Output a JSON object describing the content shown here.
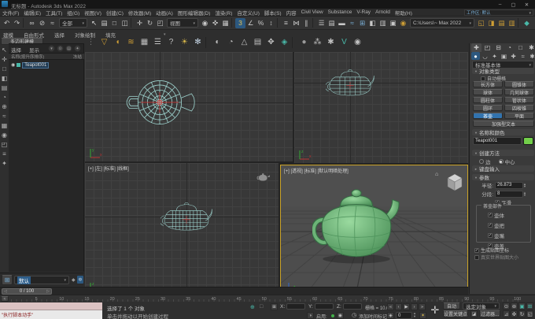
{
  "window": {
    "title": "无标题 - Autodesk 3ds Max 2022",
    "controls": [
      {
        "name": "minimize-button",
        "g": "–"
      },
      {
        "name": "maximize-button",
        "g": "▢"
      },
      {
        "name": "close-button",
        "g": "✕"
      }
    ]
  },
  "menubar": {
    "items": [
      "文件(F)",
      "编辑(E)",
      "工具(T)",
      "组(G)",
      "视图(V)",
      "创建(C)",
      "修改器(M)",
      "动画(A)",
      "图形编辑器(D)",
      "渲染(R)",
      "自定义(U)",
      "脚本(S)",
      "内容",
      "Civil View",
      "Substance",
      "V-Ray",
      "Arnold",
      "帮助(H)"
    ],
    "workspace": "工作区: 默认"
  },
  "toolbar": {
    "filter_dropdown": "全部",
    "coord_dropdown": "视图",
    "project_dropdown": "C:\\Users\\~ Max 2022",
    "icons_1": [
      {
        "cls": "ic",
        "name": "undo-icon",
        "g": "↶",
        "c": "#c8c8c8"
      },
      {
        "cls": "ic",
        "name": "redo-icon",
        "g": "↷",
        "c": "#c8c8c8"
      },
      {
        "cls": "tsep",
        "name": "toolbar-separator",
        "g": "",
        "c": ""
      },
      {
        "cls": "ic",
        "name": "select-and-link-icon",
        "g": "∞",
        "c": "#c8c8c8"
      },
      {
        "cls": "ic",
        "name": "unlink-selection-icon",
        "g": "⊘",
        "c": "#c8c8c8"
      },
      {
        "cls": "ic",
        "name": "bind-to-space-warp-icon",
        "g": "≈",
        "c": "#c8c8c8"
      }
    ],
    "icons_2": [
      {
        "cls": "ic",
        "name": "select-object-icon",
        "g": "↖",
        "c": "#d8d8d8"
      },
      {
        "cls": "ic",
        "name": "select-by-name-icon",
        "g": "▤",
        "c": "#c8c8c8"
      },
      {
        "cls": "ic",
        "name": "rectangular-selection-icon",
        "g": "□",
        "c": "#c8c8c8"
      },
      {
        "cls": "ic",
        "name": "window-crossing-icon",
        "g": "◫",
        "c": "#c8c8c8"
      },
      {
        "cls": "tsep",
        "name": "toolbar-separator",
        "g": "",
        "c": ""
      },
      {
        "cls": "ic",
        "name": "select-and-move-icon",
        "g": "✛",
        "c": "#d8d8d8"
      },
      {
        "cls": "ic",
        "name": "select-and-rotate-icon",
        "g": "↻",
        "c": "#c8c8c8"
      },
      {
        "cls": "ic",
        "name": "select-and-scale-icon",
        "g": "◰",
        "c": "#c8c8c8"
      }
    ],
    "icons_3": [
      {
        "cls": "ic",
        "name": "use-pivot-center-icon",
        "g": "◉",
        "c": "#c8c8c8"
      },
      {
        "cls": "ic",
        "name": "select-and-manipulate-icon",
        "g": "✜",
        "c": "#c8c8c8"
      },
      {
        "cls": "ic",
        "name": "keyboard-shortcut-override-icon",
        "g": "▦",
        "c": "#c8c8c8"
      },
      {
        "cls": "tsep",
        "name": "toolbar-separator",
        "g": "",
        "c": ""
      },
      {
        "cls": "ic on",
        "name": "snap-toggle-icon",
        "g": "3",
        "c": "#e4c35a"
      },
      {
        "cls": "ic",
        "name": "angle-snap-icon",
        "g": "∠",
        "c": "#c8c8c8"
      },
      {
        "cls": "ic",
        "name": "percent-snap-icon",
        "g": "%",
        "c": "#c8c8c8"
      },
      {
        "cls": "ic",
        "name": "spinner-snap-icon",
        "g": "↕",
        "c": "#c8c8c8"
      },
      {
        "cls": "tsep",
        "name": "toolbar-separator",
        "g": "",
        "c": ""
      },
      {
        "cls": "ic",
        "name": "named-selection-sets-icon",
        "g": "≡",
        "c": "#c8c8c8"
      },
      {
        "cls": "ic",
        "name": "mirror-icon",
        "g": "⋈",
        "c": "#c8c8c8"
      },
      {
        "cls": "ic",
        "name": "align-icon",
        "g": "∥",
        "c": "#c8c8c8"
      },
      {
        "cls": "tsep",
        "name": "toolbar-separator",
        "g": "",
        "c": ""
      },
      {
        "cls": "ic",
        "name": "toggle-scene-explorer-icon",
        "g": "☰",
        "c": "#c8c8c8"
      },
      {
        "cls": "ic",
        "name": "toggle-layer-explorer-icon",
        "g": "▤",
        "c": "#c8c8c8"
      },
      {
        "cls": "ic",
        "name": "toggle-ribbon-icon",
        "g": "▬",
        "c": "#c8c8c8"
      },
      {
        "cls": "ic",
        "name": "curve-editor-icon",
        "g": "≈",
        "c": "#7ab0d8"
      },
      {
        "cls": "ic",
        "name": "schematic-view-icon",
        "g": "⊞",
        "c": "#7ab0d8"
      },
      {
        "cls": "ic",
        "name": "material-editor-icon",
        "g": "◧",
        "c": "#c8c8c8"
      },
      {
        "cls": "ic",
        "name": "render-setup-icon",
        "g": "▥",
        "c": "#c8c8c8"
      },
      {
        "cls": "ic",
        "name": "rendered-frame-window-icon",
        "g": "▣",
        "c": "#c8c8c8"
      },
      {
        "cls": "ic",
        "name": "render-production-teapot-icon",
        "g": "◉",
        "c": "#cf9f35"
      }
    ],
    "icons_4": [
      {
        "cls": "ic",
        "name": "open-project-folder-icon",
        "g": "◱",
        "c": "#cf9f35"
      },
      {
        "cls": "ic",
        "name": "save-scene-icon",
        "g": "◨",
        "c": "#cf9f35"
      },
      {
        "cls": "ic",
        "name": "import-content-icon",
        "g": "▤",
        "c": "#cf9f35"
      },
      {
        "cls": "ic",
        "name": "export-content-icon",
        "g": "▥",
        "c": "#cf9f35"
      },
      {
        "cls": "tsep",
        "name": "toolbar-separator",
        "g": "",
        "c": ""
      },
      {
        "cls": "ic",
        "name": "substance-icon",
        "g": "◆",
        "c": "#49b8a8"
      }
    ]
  },
  "ribbon": {
    "tabs": [
      "建模",
      "自由形式",
      "选择",
      "对象绘制",
      "填充"
    ],
    "panel": "多边形建模"
  },
  "vp_toolbar": [
    {
      "cls": "vic",
      "name": "drag-handle-icon",
      "g": "⋮",
      "c": "#777777"
    },
    {
      "cls": "vic",
      "name": "selection-filter-icon",
      "g": "▽",
      "c": "#cf9f35"
    },
    {
      "cls": "vic",
      "name": "paint-select-icon",
      "g": "◖",
      "c": "#cf9f35"
    },
    {
      "cls": "vic",
      "name": "flag-set-icon",
      "g": "≋",
      "c": "#cf9f35"
    },
    {
      "cls": "vic",
      "name": "monitor-icon",
      "g": "▦",
      "c": "#c0c0c0"
    },
    {
      "cls": "vic",
      "name": "list-view-icon",
      "g": "☰",
      "c": "#c0c0c0"
    },
    {
      "cls": "vic",
      "name": "help-icon",
      "g": "?",
      "c": "#c0c0c0"
    },
    {
      "cls": "vic",
      "name": "sun-light-icon",
      "g": "☀",
      "c": "#d8b84a"
    },
    {
      "cls": "vic",
      "name": "snowflake-icon",
      "g": "✻",
      "c": "#c8d8e8"
    },
    {
      "cls": "vsep",
      "name": "toolbar-separator",
      "g": "",
      "c": ""
    },
    {
      "cls": "vic",
      "name": "sphere-shade-icon",
      "g": "◐",
      "c": "#c0c0c0"
    },
    {
      "cls": "vic",
      "name": "pie-chart-icon",
      "g": "◔",
      "c": "#c0c0c0"
    },
    {
      "cls": "vic",
      "name": "pyramid-icon",
      "g": "△",
      "c": "#c0c0c0"
    },
    {
      "cls": "vic",
      "name": "layers-icon",
      "g": "▤",
      "c": "#c0c0c0"
    },
    {
      "cls": "vic",
      "name": "pan-hand-icon",
      "g": "✥",
      "c": "#c0c0c0"
    },
    {
      "cls": "vic",
      "name": "drop-icon",
      "g": "◈",
      "c": "#49b8a8"
    },
    {
      "cls": "vsep",
      "name": "toolbar-separator",
      "g": "",
      "c": ""
    },
    {
      "cls": "vic",
      "name": "ball-icon",
      "g": "●",
      "c": "#9a9a9a"
    },
    {
      "cls": "vic",
      "name": "scatter-icon",
      "g": "⁂",
      "c": "#c0c0c0"
    },
    {
      "cls": "vic",
      "name": "gear-icon",
      "g": "✱",
      "c": "#c0c0c0"
    },
    {
      "cls": "vic",
      "name": "vray-icon",
      "g": "V",
      "c": "#49b8a8"
    },
    {
      "cls": "vic",
      "name": "arnold-icon",
      "g": "◉",
      "c": "#c0c0c0"
    }
  ],
  "left_toolbar": [
    {
      "name": "pointer-tool-icon",
      "g": "↖"
    },
    {
      "name": "move-tool-icon",
      "g": "✛"
    },
    {
      "name": "box-tool-icon",
      "g": "□"
    },
    {
      "name": "shade-tool-icon",
      "g": "◧"
    },
    {
      "name": "rows-tool-icon",
      "g": "▤"
    },
    {
      "name": "pie-tool-icon",
      "g": "◔"
    },
    {
      "name": "plus-tool-icon",
      "g": "⊕"
    },
    {
      "name": "wave-tool-icon",
      "g": "≈"
    },
    {
      "name": "grid-tool-icon",
      "g": "▦"
    },
    {
      "name": "dot-tool-icon",
      "g": "◉"
    },
    {
      "name": "corner-tool-icon",
      "g": "◰"
    },
    {
      "name": "list-tool-icon",
      "g": "≡"
    },
    {
      "name": "star-tool-icon",
      "g": "✦"
    }
  ],
  "explorer": {
    "tabs": [
      "选择",
      "显示"
    ],
    "toolbar_icons": [
      {
        "name": "explorer-menu-icon",
        "g": "▾"
      },
      {
        "name": "explorer-find-icon",
        "g": "⊙"
      },
      {
        "name": "explorer-list-icon",
        "g": "▤"
      },
      {
        "name": "explorer-pin-icon",
        "g": "✦"
      }
    ],
    "header_name": "名称(按升序排序)",
    "header_frozen": "冻结",
    "item_name": "Teapot001"
  },
  "viewports": {
    "bottom_left_label": "[+] [左] [标准] [线框]",
    "perspective_label": "[+] [透视] [标准] [默认明暗处理]"
  },
  "command_panel": {
    "tabs": [
      {
        "cls": "ct on",
        "name": "create-tab-icon",
        "g": "✚"
      },
      {
        "cls": "ct",
        "name": "modify-tab-icon",
        "g": "◰"
      },
      {
        "cls": "ct",
        "name": "hierarchy-tab-icon",
        "g": "⊟"
      },
      {
        "cls": "ct",
        "name": "motion-tab-icon",
        "g": "◔"
      },
      {
        "cls": "ct",
        "name": "display-tab-icon",
        "g": "□"
      },
      {
        "cls": "ct",
        "name": "utilities-tab-icon",
        "g": "✱"
      }
    ],
    "categories": [
      {
        "cls": "cc on",
        "name": "geometry-category-icon",
        "g": "●"
      },
      {
        "cls": "cc",
        "name": "shapes-category-icon",
        "g": "◡"
      },
      {
        "cls": "cc",
        "name": "lights-category-icon",
        "g": "✦"
      },
      {
        "cls": "cc",
        "name": "cameras-category-icon",
        "g": "▣"
      },
      {
        "cls": "cc",
        "name": "helpers-category-icon",
        "g": "✚"
      },
      {
        "cls": "cc",
        "name": "space-warps-category-icon",
        "g": "≈"
      },
      {
        "cls": "cc",
        "name": "systems-category-icon",
        "g": "✱"
      }
    ],
    "dropdown": "标准基本体",
    "rollout_object_type": "对象类型",
    "autogrid": "自动栅格",
    "buttons": [
      {
        "cls": "cpb",
        "label": "长方体"
      },
      {
        "cls": "cpb",
        "label": "圆锥体"
      },
      {
        "cls": "cpb",
        "label": "球体"
      },
      {
        "cls": "cpb",
        "label": "几何球体"
      },
      {
        "cls": "cpb",
        "label": "圆柱体"
      },
      {
        "cls": "cpb",
        "label": "管状体"
      },
      {
        "cls": "cpb",
        "label": "圆环"
      },
      {
        "cls": "cpb",
        "label": "四棱锥"
      },
      {
        "cls": "cpb on",
        "label": "茶壶"
      },
      {
        "cls": "cpb",
        "label": "平面"
      }
    ],
    "wide_button": "加强型文本",
    "rollout_name_color": "名称和颜色",
    "object_name": "Teapot001",
    "swatch_color": "#72ce4a",
    "rollout_creation_method": "创建方法",
    "edge_label": "边",
    "center_label": "中心",
    "rollout_keyboard_entry": "键盘输入",
    "rollout_parameters": "参数",
    "params": {
      "radius_label": "半径:",
      "radius": "26.873",
      "segments_label": "分段:",
      "segments": "8",
      "smooth": "平滑",
      "parts_group": "茶壶部件",
      "parts": [
        "壶体",
        "壶把",
        "壶嘴",
        "壶盖"
      ],
      "gen_map": "生成贴图坐标",
      "real_world": "真实世界贴图大小"
    }
  },
  "layout_bar": {
    "preset": "默认"
  },
  "timeline": {
    "slider": "0 / 100",
    "ticks": [
      "5",
      "10",
      "15",
      "20",
      "25",
      "30",
      "35",
      "40",
      "45",
      "50",
      "55",
      "60",
      "65",
      "70",
      "75",
      "80",
      "85",
      "90",
      "95",
      "100"
    ]
  },
  "status": {
    "listener_text": "\"执行脚本动手\"",
    "status_line": "选择了 1 个 对象",
    "prompt_line": "单击并拖动以开始创建过程",
    "x_label": "X:",
    "y_label": "Y:",
    "z_label": "Z:",
    "grid_label": "栅格 = 10.0",
    "enable_label": "启用:",
    "time_tag": "添加时间标记",
    "auto_key": "自动",
    "set_key": "设置关键点",
    "selection_set": "选定对象",
    "filters": "过滤器...",
    "frame": "0",
    "playback": [
      {
        "name": "go-to-start-icon",
        "g": "«"
      },
      {
        "name": "previous-frame-icon",
        "g": "‹"
      },
      {
        "name": "play-icon",
        "g": "▶"
      },
      {
        "name": "next-frame-icon",
        "g": "›"
      },
      {
        "name": "go-to-end-icon",
        "g": "»"
      }
    ],
    "nav": [
      {
        "name": "zoom-icon",
        "g": "⊙",
        "c": "#c0c0c0"
      },
      {
        "name": "zoom-all-icon",
        "g": "⊚",
        "c": "#c0c0c0"
      },
      {
        "name": "zoom-extents-icon",
        "g": "▣",
        "c": "#49b8a8"
      },
      {
        "name": "zoom-extents-all-icon",
        "g": "⊞",
        "c": "#49b8a8"
      },
      {
        "name": "field-of-view-icon",
        "g": "⊿",
        "c": "#c0c0c0"
      },
      {
        "name": "pan-view-icon",
        "g": "✜",
        "c": "#c0c0c0"
      },
      {
        "name": "orbit-icon",
        "g": "↻",
        "c": "#c0c0c0"
      },
      {
        "name": "maximize-viewport-icon",
        "g": "◱",
        "c": "#c0c0c0"
      }
    ]
  }
}
